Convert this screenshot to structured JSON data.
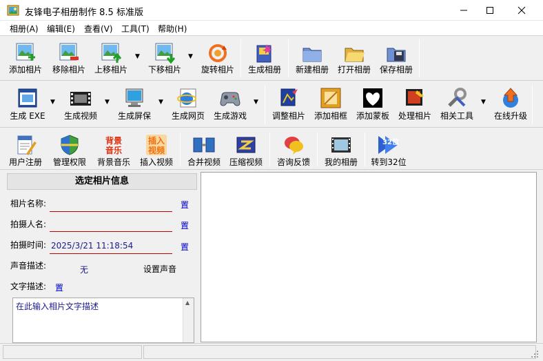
{
  "window": {
    "title": "友锋电子相册制作 8.5 标准版"
  },
  "menu": [
    "相册(A)",
    "编辑(E)",
    "查看(V)",
    "工具(T)",
    "帮助(H)"
  ],
  "toolbar1": [
    "添加相片",
    "移除相片",
    "上移相片",
    "下移相片",
    "旋转相片",
    "生成相册",
    "新建相册",
    "打开相册",
    "保存相册"
  ],
  "toolbar2": [
    "生成 EXE",
    "生成视频",
    "生成屏保",
    "生成网页",
    "生成游戏",
    "调整相片",
    "添加相框",
    "添加蒙板",
    "处理相片",
    "相关工具",
    "在线升级"
  ],
  "toolbar3": [
    "用户注册",
    "管理权限",
    "背景音乐",
    "插入视频",
    "合并视频",
    "压缩视频",
    "咨询反馈",
    "我的相册",
    "转到32位"
  ],
  "icon_text": {
    "music": "背景\n音乐",
    "video": "插入\n视频",
    "bit32": "32位"
  },
  "info_panel": {
    "header": "选定相片信息",
    "name_label": "相片名称:",
    "photographer_label": "拍摄人名:",
    "time_label": "拍摄时间:",
    "time_value": "2025/3/21 11:18:54",
    "sound_label": "声音描述:",
    "sound_value": "无",
    "set_sound": "设置声音",
    "text_label": "文字描述:",
    "edit_glyph": "置",
    "desc_placeholder": "在此输入相片文字描述"
  }
}
